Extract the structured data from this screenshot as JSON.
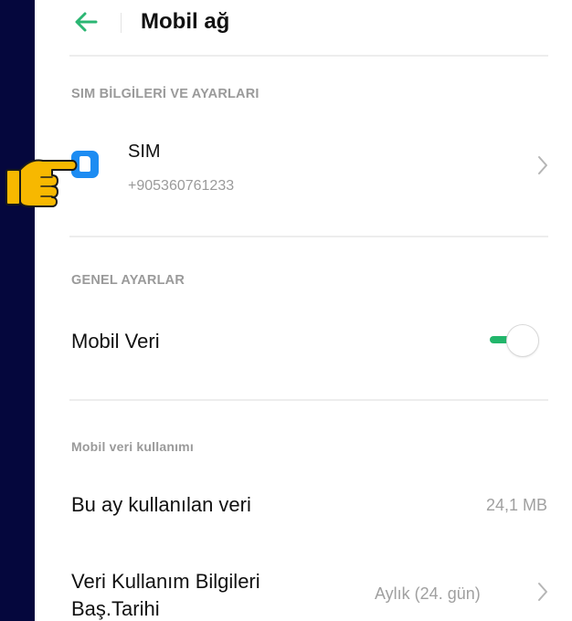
{
  "header": {
    "title": "Mobil ağ",
    "back_icon": "arrow-left-icon",
    "accent": "#2bb673"
  },
  "sim_section": {
    "heading": "SIM BİLGİLERİ VE AYARLARI",
    "sim": {
      "title": "SIM",
      "number": "+905360761233",
      "icon": "sim-card-icon",
      "icon_color": "#1d8cf2"
    }
  },
  "general_section": {
    "heading": "GENEL AYARLAR",
    "mobile_data": {
      "label": "Mobil Veri",
      "enabled": true,
      "toggle_color": "#22b66b"
    }
  },
  "usage_section": {
    "heading": "Mobil veri kullanımı",
    "used_this_month": {
      "label": "Bu ay kullanılan veri",
      "value": "24,1 MB"
    },
    "cycle_start": {
      "label_line1": "Veri Kullanım Bilgileri",
      "label_line2": "Baş.Tarihi",
      "value": "Aylık (24. gün)"
    }
  },
  "overlay": {
    "icon": "pointing-hand-icon",
    "color": "#f7b800"
  }
}
